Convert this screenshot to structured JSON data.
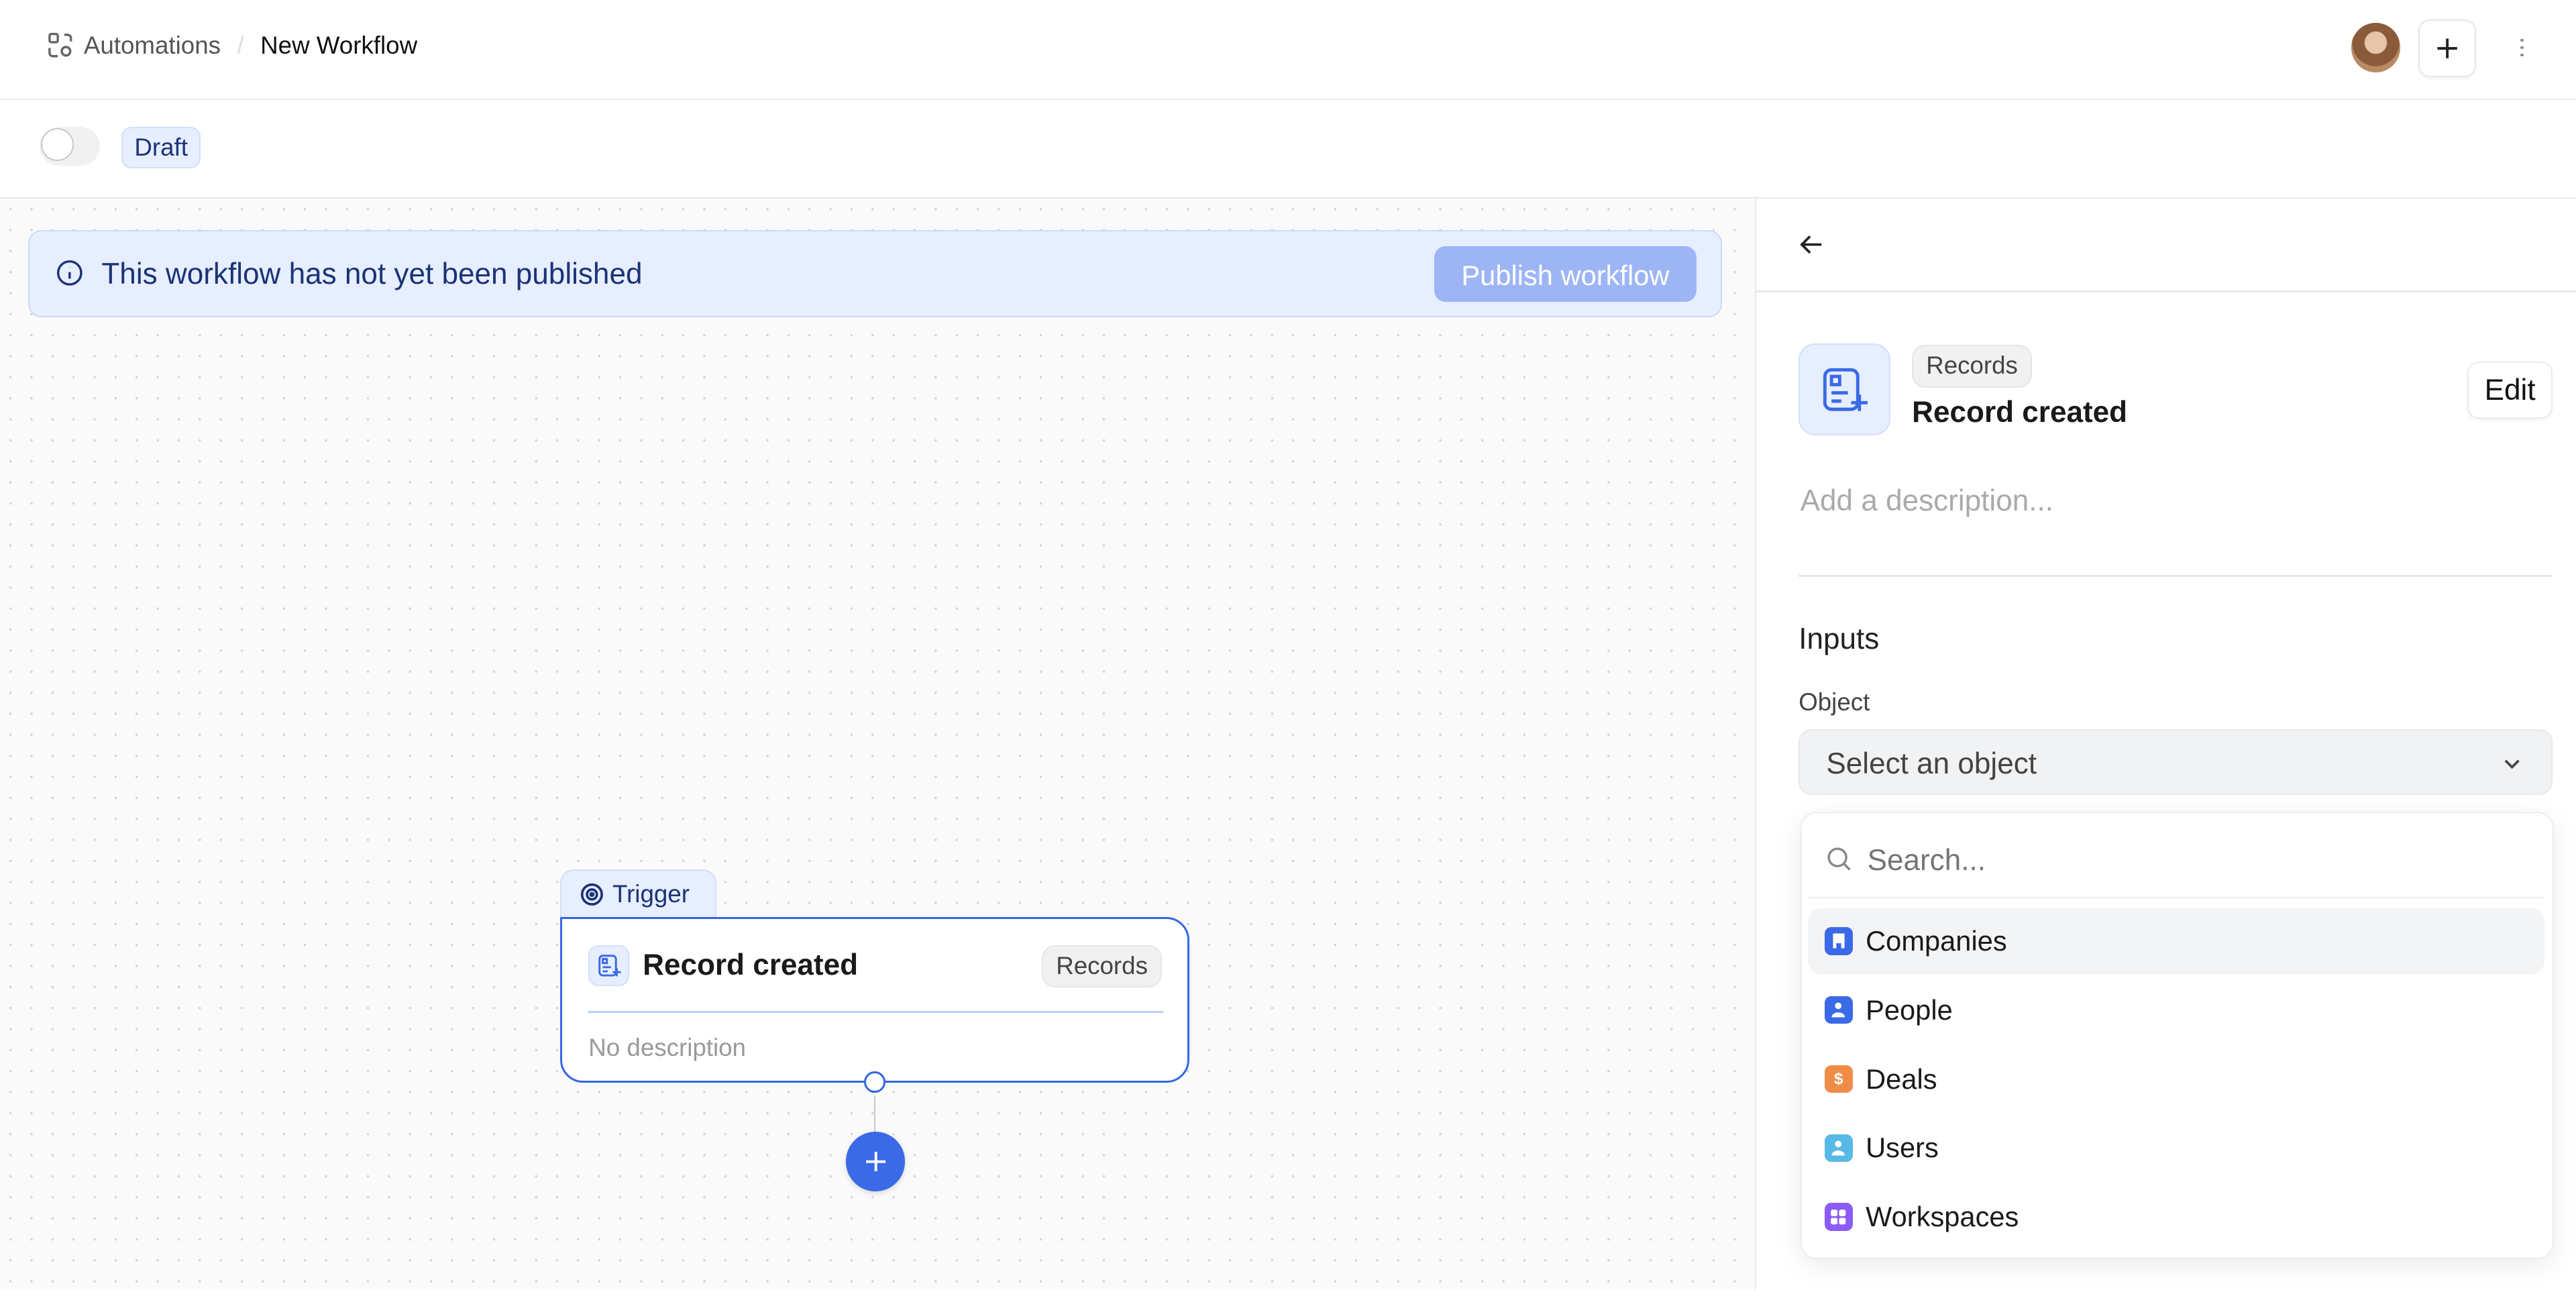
{
  "header": {
    "breadcrumb_parent": "Automations",
    "separator": "/",
    "title": "New Workflow"
  },
  "toolbar": {
    "status_badge": "Draft"
  },
  "banner": {
    "message": "This workflow has not yet been published",
    "publish_label": "Publish workflow"
  },
  "node": {
    "tab_label": "Trigger",
    "title": "Record created",
    "badge": "Records",
    "description": "No description"
  },
  "panel": {
    "badge": "Records",
    "title": "Record created",
    "edit_label": "Edit",
    "description_placeholder": "Add a description...",
    "inputs_heading": "Inputs",
    "object_label": "Object",
    "select_placeholder": "Select an object",
    "search_placeholder": "Search...",
    "options": [
      {
        "label": "Companies",
        "color": "#3b6ae6",
        "icon": "building-icon"
      },
      {
        "label": "People",
        "color": "#3b6ae6",
        "icon": "person-icon"
      },
      {
        "label": "Deals",
        "color": "#ef8d48",
        "icon": "dollar-icon"
      },
      {
        "label": "Users",
        "color": "#57b9e6",
        "icon": "person-icon"
      },
      {
        "label": "Workspaces",
        "color": "#8b5cf6",
        "icon": "grid-icon"
      }
    ]
  }
}
